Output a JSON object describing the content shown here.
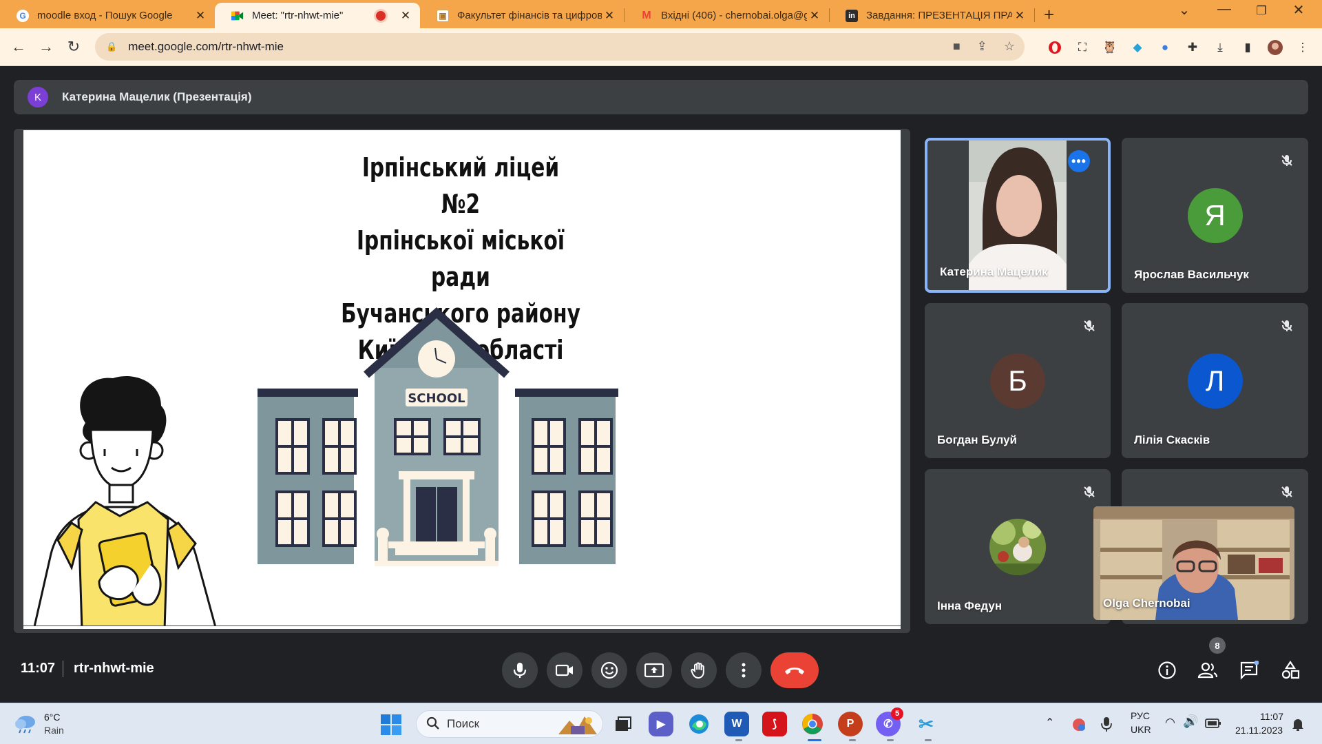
{
  "browser": {
    "tabs": [
      {
        "title": "moodle вход - Пошук Google",
        "icon": "google-icon"
      },
      {
        "title": "Meet: \"rtr-nhwt-mie\"",
        "icon": "meet-icon",
        "active": true
      },
      {
        "title": "Факультет фінансів та цифрови",
        "icon": "page-icon"
      },
      {
        "title": "Вхідні (406) - chernobai.olga@g",
        "icon": "gmail-icon"
      },
      {
        "title": "Завдання: ПРЕЗЕНТАЦІЯ ПРАКТ",
        "icon": "classroom-icon"
      }
    ],
    "url": "meet.google.com/rtr-nhwt-mie"
  },
  "meet": {
    "presenter_initial": "K",
    "presenter_label": "Катерина Мацелик (Презентація)",
    "slide": {
      "title_lines": [
        "Ірпінський ліцей №2",
        "Ірпінської міської ради",
        "Бучанського району",
        "Київської області"
      ],
      "school_sign": "SCHOOL"
    },
    "participants": [
      {
        "name": "Катерина Мацелик",
        "video": true,
        "speaking": true
      },
      {
        "name": "Ярослав Васильчук",
        "initial": "Я",
        "color": "#4a9c3a",
        "muted": true
      },
      {
        "name": "Богдан Булуй",
        "initial": "Б",
        "color": "#5b3a32",
        "muted": true
      },
      {
        "name": "Лілія Скасків",
        "initial": "Л",
        "color": "#0b57d0",
        "muted": true
      },
      {
        "name": "Інна Федун",
        "photo": true,
        "muted": true
      },
      {
        "name": "Olga Chernobai",
        "self": true
      }
    ],
    "time": "11:07",
    "meeting_code": "rtr-nhwt-mie",
    "people_count": "8"
  },
  "taskbar": {
    "weather_temp": "6°C",
    "weather_desc": "Rain",
    "search_placeholder": "Поиск",
    "viber_badge": "5",
    "lang_top": "РУС",
    "lang_bottom": "UKR",
    "time": "11:07",
    "date": "21.11.2023"
  }
}
